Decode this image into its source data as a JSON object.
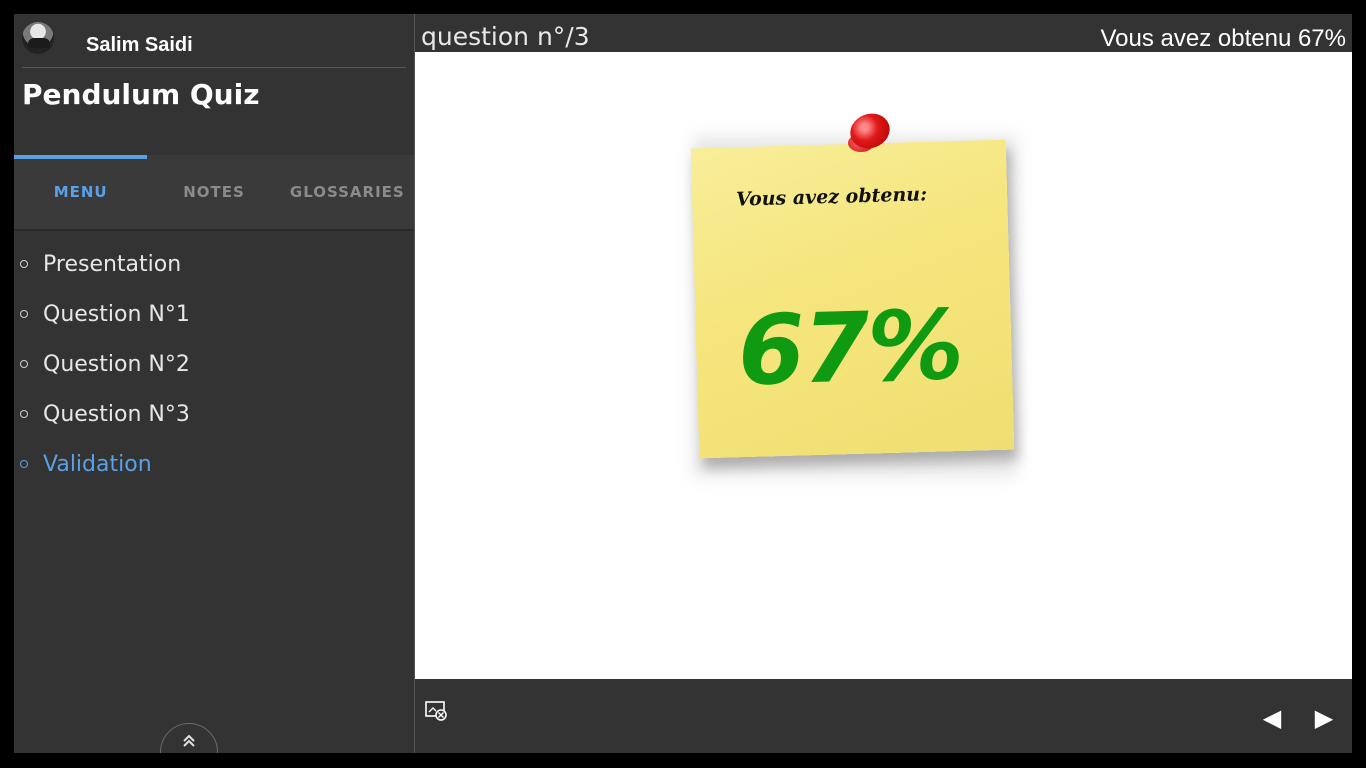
{
  "author": {
    "name": "Salim Saidi",
    "avatar_icon": "avatar-photo"
  },
  "course": {
    "title": "Pendulum Quiz"
  },
  "tabs": [
    {
      "label": "MENU",
      "active": true
    },
    {
      "label": "NOTES",
      "active": false
    },
    {
      "label": "GLOSSARIES",
      "active": false
    }
  ],
  "menu": {
    "items": [
      {
        "label": "Presentation",
        "active": false
      },
      {
        "label": "Question N°1",
        "active": false
      },
      {
        "label": "Question N°2",
        "active": false
      },
      {
        "label": "Question N°3",
        "active": false
      },
      {
        "label": "Validation",
        "active": true
      }
    ]
  },
  "header": {
    "question_label": "question n°/3",
    "score_text": "Vous avez obtenu 67%"
  },
  "note": {
    "title": "Vous avez obtenu:",
    "score": "67%"
  },
  "controls": {
    "collapse_icon": "double-chevron-up-icon",
    "prev_icon": "◀",
    "next_icon": "▶",
    "screen_icon": "screen-settings-icon"
  },
  "colors": {
    "accent": "#5aa0e6",
    "panel": "#333333",
    "note_yellow": "#f5e57c",
    "score_green": "#0f9a12",
    "pin_red": "#e01818"
  }
}
